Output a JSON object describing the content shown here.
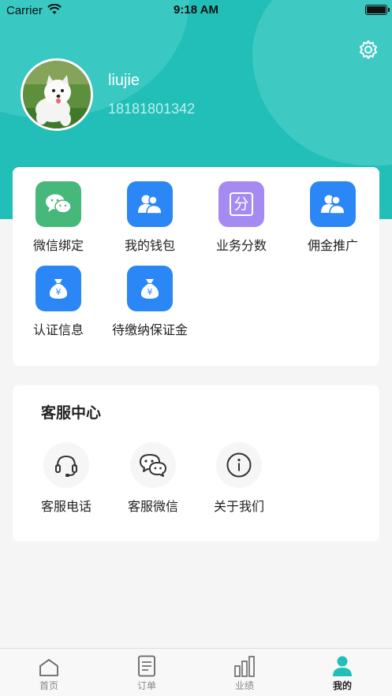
{
  "status_bar": {
    "carrier": "Carrier",
    "time": "9:18 AM"
  },
  "profile": {
    "username": "liujie",
    "phone": "18181801342"
  },
  "header_icons": {
    "settings": "gear-icon"
  },
  "feature_grid": {
    "items": [
      {
        "label": "微信绑定",
        "icon": "wechat-icon",
        "color": "#46b87a"
      },
      {
        "label": "我的钱包",
        "icon": "users-icon",
        "color": "#2b87f5"
      },
      {
        "label": "业务分数",
        "icon": "score-icon",
        "glyph": "分",
        "color": "#a58af2"
      },
      {
        "label": "佣金推广",
        "icon": "user-icon",
        "color": "#2b87f5"
      },
      {
        "label": "认证信息",
        "icon": "money-bag-icon",
        "glyph": "¥",
        "color": "#2b87f5"
      },
      {
        "label": "待缴纳保证金",
        "icon": "money-bag-icon",
        "glyph": "¥",
        "color": "#2b87f5"
      }
    ]
  },
  "service_center": {
    "title": "客服中心",
    "items": [
      {
        "label": "客服电话",
        "icon": "headset-icon"
      },
      {
        "label": "客服微信",
        "icon": "wechat-outline-icon"
      },
      {
        "label": "关于我们",
        "icon": "info-icon"
      }
    ]
  },
  "tab_bar": {
    "items": [
      {
        "label": "首页",
        "icon": "home-icon"
      },
      {
        "label": "订单",
        "icon": "document-icon"
      },
      {
        "label": "业绩",
        "icon": "bar-chart-icon"
      },
      {
        "label": "我的",
        "icon": "person-icon",
        "active": true
      }
    ]
  },
  "colors": {
    "header": "#21bfb8",
    "accent_blue": "#2b87f5",
    "active_tab": "#21bfb8"
  }
}
